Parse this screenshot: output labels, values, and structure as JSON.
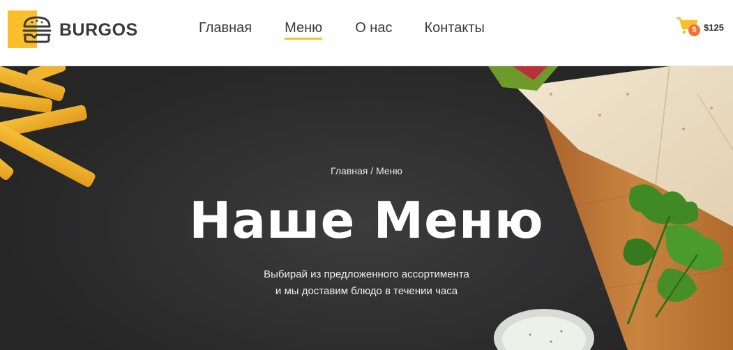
{
  "header": {
    "logo": {
      "text": "BURGOS",
      "icon": "burger-icon",
      "accent": "#fbbf2b"
    },
    "nav": [
      {
        "label": "Главная",
        "active": false
      },
      {
        "label": "Меню",
        "active": true
      },
      {
        "label": "О нас",
        "active": false
      },
      {
        "label": "Контакты",
        "active": false
      }
    ],
    "cart": {
      "icon": "cart-icon",
      "count": "5",
      "total": "$125",
      "badge_color": "#ee7631",
      "icon_color": "#fbbf2b"
    }
  },
  "hero": {
    "breadcrumb": {
      "home": "Главная",
      "separator": " / ",
      "current": "Меню"
    },
    "title": "Наше Меню",
    "subtitle_line1": "Выбирай из предложенного ассортимента",
    "subtitle_line2": "и мы доставим блюдо в течении часа"
  }
}
